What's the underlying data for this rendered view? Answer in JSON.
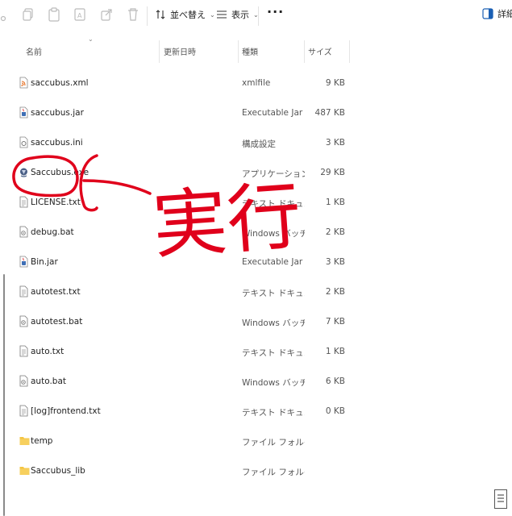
{
  "toolbar": {
    "sort_label": "並べ替え",
    "view_label": "表示",
    "more_label": "···",
    "details_label": "詳細"
  },
  "columns": {
    "name": "名前",
    "date": "更新日時",
    "type": "種類",
    "size": "サイズ"
  },
  "files": [
    {
      "name": "saccubus.xml",
      "date": "",
      "type": "xmlfile",
      "size": "9 KB",
      "icon": "xml-file-icon"
    },
    {
      "name": "saccubus.jar",
      "date": "",
      "type": "Executable Jar File",
      "size": "487 KB",
      "icon": "jar-file-icon"
    },
    {
      "name": "saccubus.ini",
      "date": "",
      "type": "構成設定",
      "size": "3 KB",
      "icon": "ini-file-icon"
    },
    {
      "name": "Saccubus.exe",
      "date": "",
      "type": "アプリケーション",
      "size": "29 KB",
      "icon": "exe-file-icon"
    },
    {
      "name": "LICENSE.txt",
      "date": "",
      "type": "テキスト ドキュメント",
      "size": "1 KB",
      "icon": "text-file-icon"
    },
    {
      "name": "debug.bat",
      "date": "",
      "type": "Windows バッチ ファ...",
      "size": "2 KB",
      "icon": "bat-file-icon"
    },
    {
      "name": "Bin.jar",
      "date": "",
      "type": "Executable Jar File",
      "size": "3 KB",
      "icon": "jar-file-icon"
    },
    {
      "name": "autotest.txt",
      "date": "",
      "type": "テキスト ドキュメント",
      "size": "2 KB",
      "icon": "text-file-icon"
    },
    {
      "name": "autotest.bat",
      "date": "",
      "type": "Windows バッチ ファ...",
      "size": "7 KB",
      "icon": "bat-file-icon"
    },
    {
      "name": "auto.txt",
      "date": "",
      "type": "テキスト ドキュメント",
      "size": "1 KB",
      "icon": "text-file-icon"
    },
    {
      "name": "auto.bat",
      "date": "",
      "type": "Windows バッチ ファ...",
      "size": "6 KB",
      "icon": "bat-file-icon"
    },
    {
      "name": "[log]frontend.txt",
      "date": "",
      "type": "テキスト ドキュメント",
      "size": "0 KB",
      "icon": "text-file-icon"
    },
    {
      "name": "temp",
      "date": "",
      "type": "ファイル フォルダー",
      "size": "",
      "icon": "folder-icon"
    },
    {
      "name": "Saccubus_lib",
      "date": "",
      "type": "ファイル フォルダー",
      "size": "",
      "icon": "folder-icon"
    }
  ],
  "annotation": {
    "text": "実行",
    "color": "#e0001b"
  },
  "colors": {
    "folder": "#f4c542",
    "annotation": "#e0001b",
    "xml_icon": "#e46b1b"
  }
}
